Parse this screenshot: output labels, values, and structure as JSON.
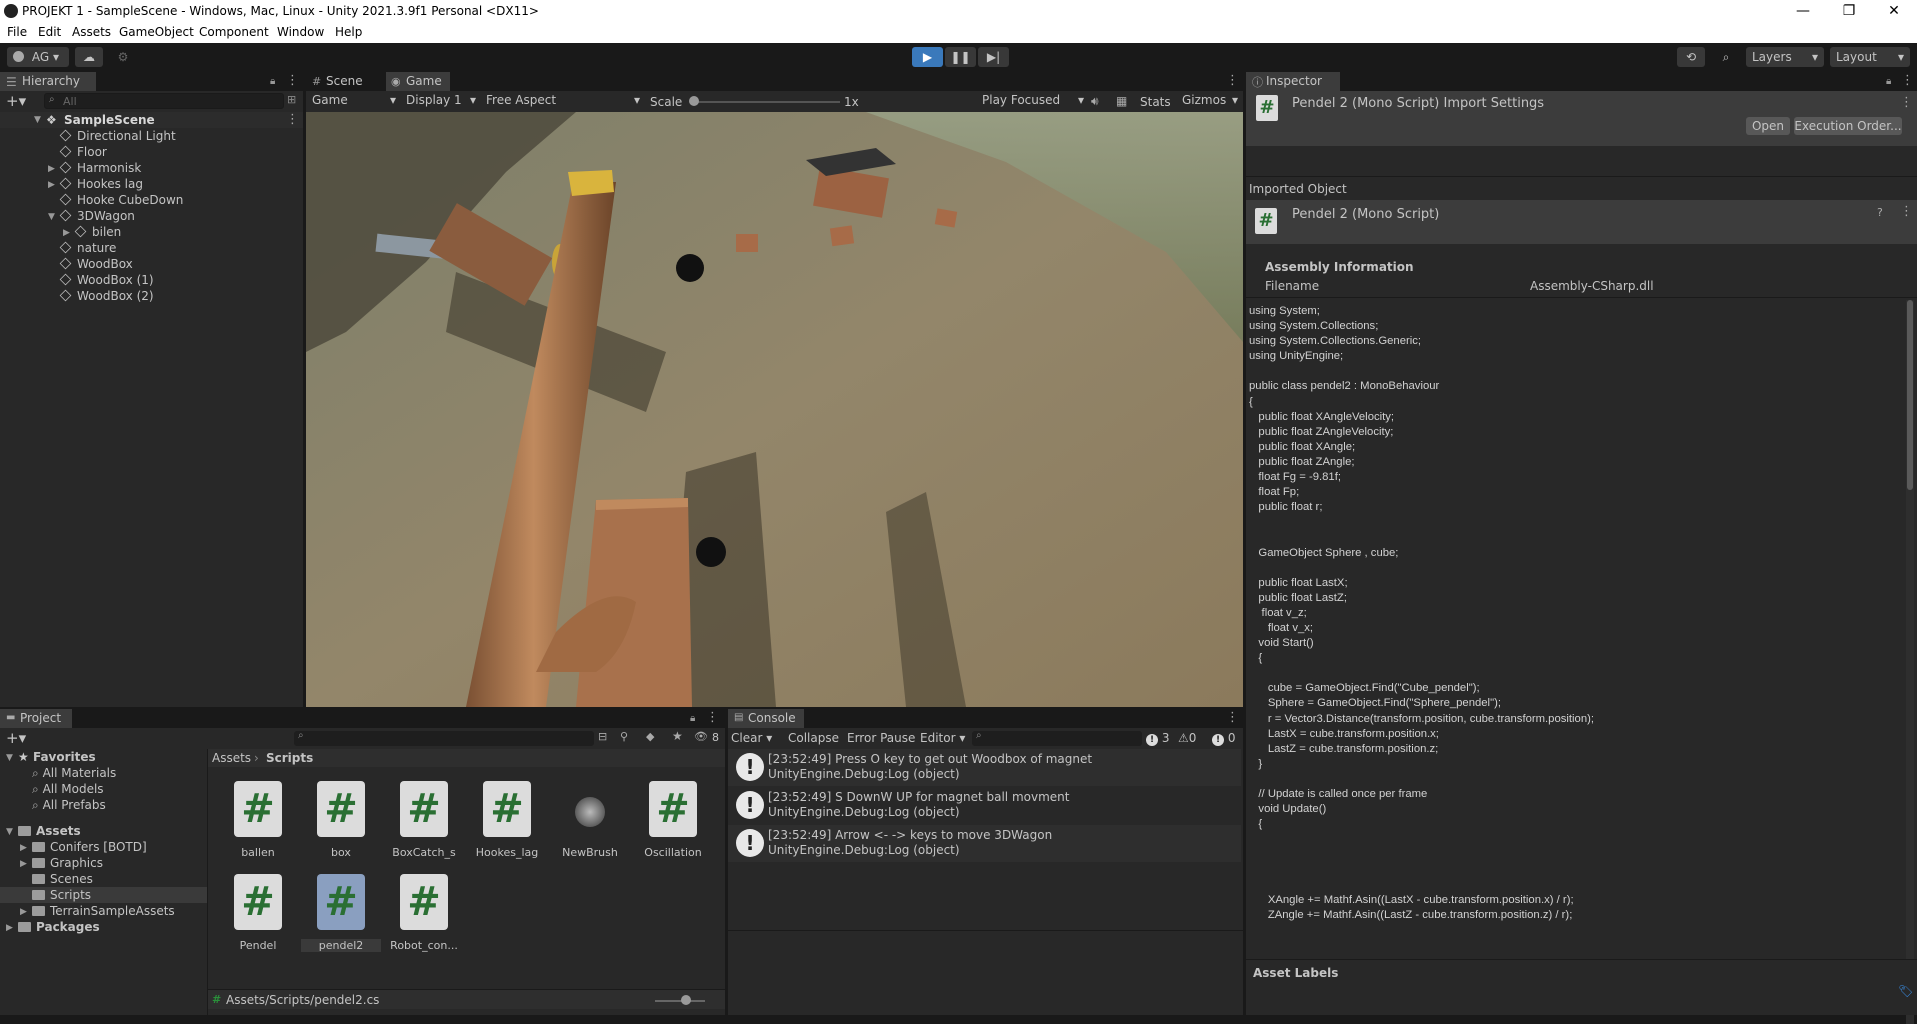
{
  "window": {
    "title": "PROJEKT 1 - SampleScene - Windows, Mac, Linux - Unity 2021.3.9f1 Personal <DX11>",
    "controls": [
      "—",
      "❐",
      "✕"
    ]
  },
  "menu": [
    "File",
    "Edit",
    "Assets",
    "GameObject",
    "Component",
    "Window",
    "Help"
  ],
  "toolbar": {
    "account": "AG",
    "layers": "Layers",
    "layout": "Layout"
  },
  "hierarchy": {
    "tab": "Hierarchy",
    "search_placeholder": "All",
    "scene": "SampleScene",
    "items": [
      {
        "label": "Directional Light"
      },
      {
        "label": "Floor"
      },
      {
        "label": "Harmonisk"
      },
      {
        "label": "Hookes lag"
      },
      {
        "label": "Hooke CubeDown"
      },
      {
        "label": "3DWagon"
      },
      {
        "label": "bilen"
      },
      {
        "label": "nature"
      },
      {
        "label": "WoodBox"
      },
      {
        "label": "WoodBox (1)"
      },
      {
        "label": "WoodBox (2)"
      }
    ]
  },
  "gameview": {
    "tabs": [
      "Scene",
      "Game"
    ],
    "game_dropdown": "Game",
    "display": "Display 1",
    "aspect": "Free Aspect",
    "scale_label": "Scale",
    "scale_value": "1x",
    "play_mode": "Play Focused",
    "stats": "Stats",
    "gizmos": "Gizmos"
  },
  "inspector": {
    "tab": "Inspector",
    "header_title": "Pendel 2 (Mono Script) Import Settings",
    "open_btn": "Open",
    "exec_btn": "Execution Order...",
    "imported_object": "Imported Object",
    "object_title": "Pendel 2 (Mono Script)",
    "assembly_info": "Assembly Information",
    "filename_label": "Filename",
    "filename_value": "Assembly-CSharp.dll",
    "code": "using System;\nusing System.Collections;\nusing System.Collections.Generic;\nusing UnityEngine;\n\npublic class pendel2 : MonoBehaviour\n{\n   public float XAngleVelocity;\n   public float ZAngleVelocity;\n   public float XAngle;\n   public float ZAngle;\n   float Fg = -9.81f;\n   float Fp;\n   public float r;\n\n\n   GameObject Sphere , cube;\n\n   public float LastX;\n   public float LastZ;\n    float v_z;\n      float v_x;\n   void Start()\n   {\n\n      cube = GameObject.Find(\"Cube_pendel\");\n      Sphere = GameObject.Find(\"Sphere_pendel\");\n      r = Vector3.Distance(transform.position, cube.transform.position);\n      LastX = cube.transform.position.x;\n      LastZ = cube.transform.position.z;\n   }\n\n   // Update is called once per frame\n   void Update()\n   {\n\n\n\n\n      XAngle += Mathf.Asin((LastX - cube.transform.position.x) / r);\n      ZAngle += Mathf.Asin((LastZ - cube.transform.position.z) / r);",
    "asset_labels": "Asset Labels"
  },
  "project": {
    "tab": "Project",
    "favorites": "Favorites",
    "fav_items": [
      "All Materials",
      "All Models",
      "All Prefabs"
    ],
    "assets": "Assets",
    "asset_folders": [
      "Conifers [BOTD]",
      "Graphics",
      "Scenes",
      "Scripts",
      "TerrainSampleAssets"
    ],
    "packages": "Packages",
    "breadcrumb": [
      "Assets",
      "Scripts"
    ],
    "files": [
      {
        "name": "ballen",
        "kind": "script"
      },
      {
        "name": "box",
        "kind": "script"
      },
      {
        "name": "BoxCatch_s",
        "kind": "script"
      },
      {
        "name": "Hookes_lag",
        "kind": "script"
      },
      {
        "name": "NewBrush",
        "kind": "brush"
      },
      {
        "name": "Oscillation",
        "kind": "script"
      },
      {
        "name": "Pendel",
        "kind": "script"
      },
      {
        "name": "pendel2",
        "kind": "script"
      },
      {
        "name": "Robot_con...",
        "kind": "script"
      }
    ],
    "status_path": "Assets/Scripts/pendel2.cs",
    "hidden_count": "8"
  },
  "console": {
    "tab": "Console",
    "clear": "Clear",
    "collapse": "Collapse",
    "error_pause": "Error Pause",
    "editor": "Editor",
    "count_info": "3",
    "count_warn": "0",
    "count_err": "0",
    "logs": [
      {
        "line1": "[23:52:49] Press O key to get out Woodbox of magnet",
        "line2": "UnityEngine.Debug:Log (object)"
      },
      {
        "line1": "[23:52:49] S DownW UP for magnet ball movment",
        "line2": "UnityEngine.Debug:Log (object)"
      },
      {
        "line1": "[23:52:49] Arrow <- -> keys to move 3DWagon",
        "line2": "UnityEngine.Debug:Log (object)"
      }
    ]
  },
  "colors": {
    "accent": "#3a79bb",
    "panel": "#282828",
    "tabbar": "#191919"
  }
}
